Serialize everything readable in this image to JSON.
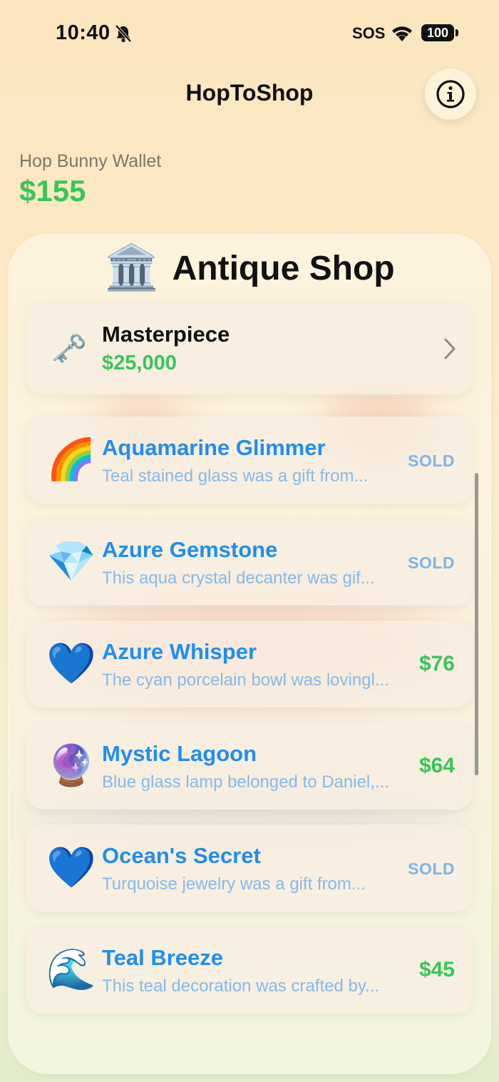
{
  "status_bar": {
    "time": "10:40",
    "sos": "SOS",
    "battery": "100"
  },
  "nav": {
    "title": "HopToShop",
    "info_icon": "info-circle-icon"
  },
  "wallet": {
    "label": "Hop Bunny Wallet",
    "amount": "$155"
  },
  "shop": {
    "icon": "🏛️",
    "title": "Antique Shop",
    "masterpiece": {
      "icon": "🗝️",
      "label": "Masterpiece",
      "price": "$25,000"
    },
    "items": [
      {
        "icon": "🌈",
        "name": "Aquamarine Glimmer",
        "desc": "Teal stained glass was a gift from...",
        "status": "SOLD"
      },
      {
        "icon": "💎",
        "name": "Azure Gemstone",
        "desc": "This aqua crystal decanter was gif...",
        "status": "SOLD"
      },
      {
        "icon": "💙",
        "name": "Azure Whisper",
        "desc": "The cyan porcelain bowl was lovingl...",
        "status": "$76"
      },
      {
        "icon": "🔮",
        "name": "Mystic Lagoon",
        "desc": "Blue glass lamp belonged to Daniel,...",
        "status": "$64"
      },
      {
        "icon": "💙",
        "name": "Ocean's Secret",
        "desc": "Turquoise jewelry was a gift from...",
        "status": "SOLD"
      },
      {
        "icon": "🌊",
        "name": "Teal Breeze",
        "desc": "This teal decoration was crafted by...",
        "status": "$45"
      }
    ]
  },
  "colors": {
    "price_green": "#34c759",
    "link_blue": "#1f8ef0",
    "sold_blue": "#7ab6ea",
    "background": "#fbe6bf"
  }
}
